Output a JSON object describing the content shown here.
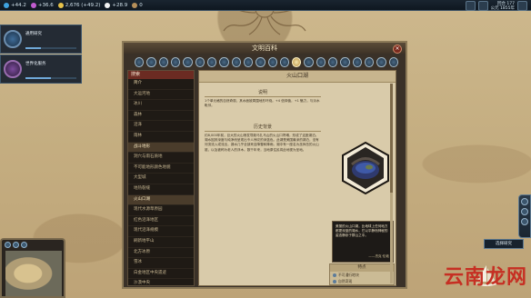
{
  "topbar": {
    "yields": [
      {
        "icon": "science-icon",
        "value": "+44.2",
        "color": "#3fa3e0"
      },
      {
        "icon": "culture-icon",
        "value": "+36.6",
        "color": "#c05cd0"
      },
      {
        "icon": "gold-icon",
        "value": "2,676 (+49.2)",
        "color": "#e6c24a"
      },
      {
        "icon": "faith-icon",
        "value": "+28.9",
        "color": "#f2f2f2"
      },
      {
        "icon": "tourism-icon",
        "value": "0",
        "color": "#b58f5a"
      }
    ],
    "era_line1": "回合 177",
    "era_line2": "公元 1855年"
  },
  "research": {
    "title": "通用研究",
    "subtitle": "",
    "progress": 0.3
  },
  "civic": {
    "title": "世界化服务",
    "subtitle": "",
    "progress": 0.5
  },
  "pedia": {
    "window_title": "文明百科",
    "close_label": "×",
    "sidebar_head": "搜索",
    "sidebar_items": [
      {
        "label": "简介",
        "active": false,
        "header": true
      },
      {
        "label": "大运河地",
        "active": false,
        "header": false
      },
      {
        "label": "冰川",
        "active": false,
        "header": false
      },
      {
        "label": "森林",
        "active": false,
        "header": false
      },
      {
        "label": "沼泽",
        "active": false,
        "header": false
      },
      {
        "label": "雨林",
        "active": false,
        "header": false
      },
      {
        "label": "战斗地形",
        "active": true,
        "header": false
      },
      {
        "label": "洞穴与雨石质地",
        "active": false,
        "header": false
      },
      {
        "label": "不可能地形颜色地貌",
        "active": false,
        "header": false
      },
      {
        "label": "大型城",
        "active": false,
        "header": false
      },
      {
        "label": "地热裂缝",
        "active": false,
        "header": false
      },
      {
        "label": "火山口湖",
        "active": true,
        "header": false
      },
      {
        "label": "现代水源草原园",
        "active": false,
        "header": false
      },
      {
        "label": "红色沼泽地区",
        "active": false,
        "header": false
      },
      {
        "label": "现代沼泽规模",
        "active": false,
        "header": false
      },
      {
        "label": "刷新地平山",
        "active": false,
        "header": false
      },
      {
        "label": "北方冰原",
        "active": false,
        "header": false
      },
      {
        "label": "雪冰",
        "active": false,
        "header": false
      },
      {
        "label": "白金地区中央遗迹",
        "active": false,
        "header": false
      },
      {
        "label": "沙漠中央",
        "active": false,
        "header": false
      },
      {
        "label": "黑色原料",
        "active": false,
        "header": false
      }
    ],
    "content_title": "火山口湖",
    "section1": "说明",
    "section1_text": "1个单元格的自然奇观，其水面被周围地形环绕。+4 信仰值，+1 魅力，与淡水毗邻。",
    "section2": "历史背景",
    "section2_text": "约8,000年前，巨大的火山喷发导致马扎马山的火山口坍塌，形成了这座湖泊。湖水因其深度与纯净而呈现出令人惊叹的深蓝色。此湖是美国最深的湖泊，没有河流流入或流出，湖水几乎全部来自降雪和降雨。湖中有一座名为巫师岛的火山锥，以及被称为老人的浮木。数千年来，当地原住民将此地视为圣地。",
    "quote": "美丽的火山口湖，比地球上任何地方都更深蓝的湖水，它以平静而神秘的姿态静卧于群山之中。",
    "quote_author": "——杰克·伦敦",
    "traits_head": "特点",
    "traits": [
      "不可通行地块",
      "自然奇观"
    ],
    "categories": [
      "home-icon",
      "civ-icon",
      "city-state-icon",
      "district-icon",
      "building-icon",
      "wonder-icon",
      "unit-icon",
      "promotion-icon",
      "great-person-icon",
      "tech-icon",
      "civic-icon",
      "government-icon",
      "religion-icon",
      "terrain-icon",
      "resource-icon",
      "improvement-icon",
      "route-icon",
      "governor-icon",
      "historic-moment-icon",
      "world-congress-icon",
      "climate-icon",
      "concept-icon"
    ]
  },
  "right": {
    "next_turn": "选择研究"
  },
  "watermark": "云南龙网"
}
